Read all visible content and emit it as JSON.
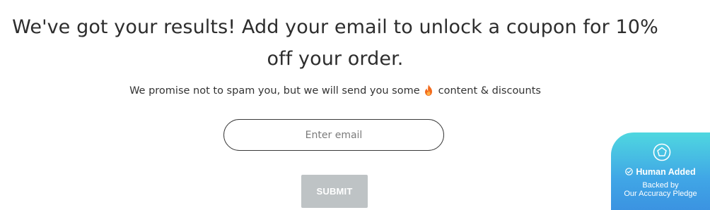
{
  "headline": {
    "line1": "We've got your results! Add your email to unlock a coupon for 10%",
    "line2": "off your order."
  },
  "subtext": {
    "before": "We promise not to spam you, but we will send you some",
    "icon": "fire-icon",
    "after": "content & discounts"
  },
  "email": {
    "placeholder": "Enter email",
    "value": ""
  },
  "submit": {
    "label": "SUBMIT"
  },
  "badge": {
    "logo_icon": "pentagon-logo-icon",
    "check_icon": "check-circle-icon",
    "title": "Human Added",
    "line1": "Backed by",
    "line2": "Our Accuracy Pledge"
  },
  "colors": {
    "submit_bg": "#bec3c5",
    "badge_top": "#4fd7e0",
    "badge_bottom": "#3a8fe0",
    "fire": "#f26b1d"
  }
}
